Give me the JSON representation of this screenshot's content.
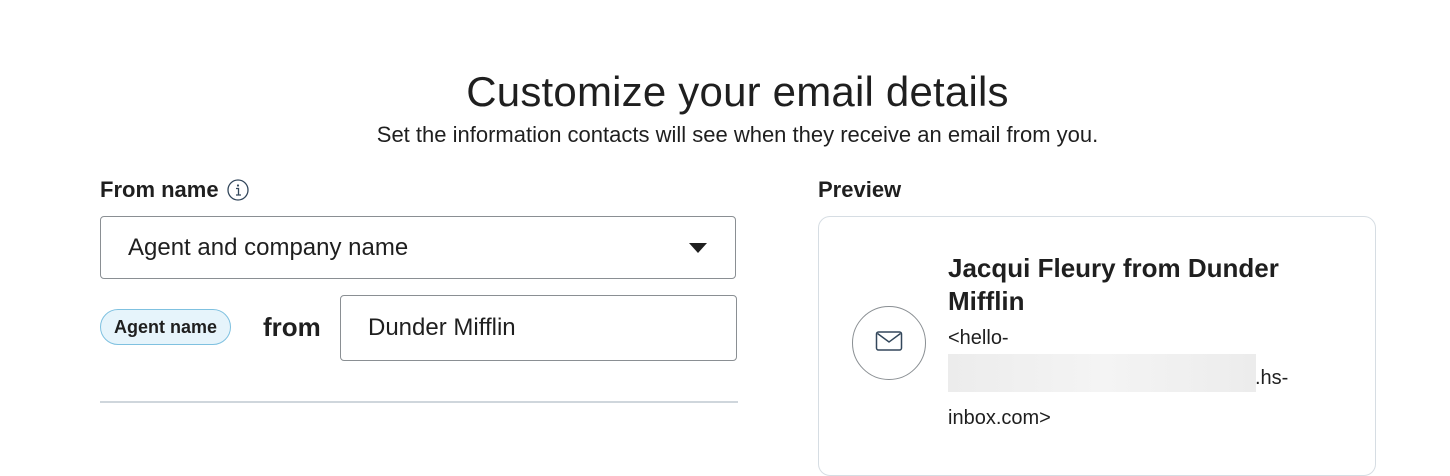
{
  "header": {
    "title": "Customize your email details",
    "subtitle": "Set the information contacts will see when they receive an email from you."
  },
  "from_name": {
    "label": "From name",
    "info_icon": "info-circle-icon",
    "select_value": "Agent and company name",
    "agent_pill": "Agent name",
    "from_word": "from",
    "company_value": "Dunder Mifflin"
  },
  "preview": {
    "label": "Preview",
    "sender_name": "Jacqui Fleury from Dunder Mifflin",
    "address_line_1": "<hello-",
    "address_line_2": ".hs-",
    "address_line_3": "inbox.com>",
    "avatar_icon": "envelope-icon"
  },
  "colors": {
    "pill_bg": "#e6f4fb",
    "pill_border": "#7fc1e0",
    "text": "#1f1f1f",
    "border": "#8a8f93"
  }
}
